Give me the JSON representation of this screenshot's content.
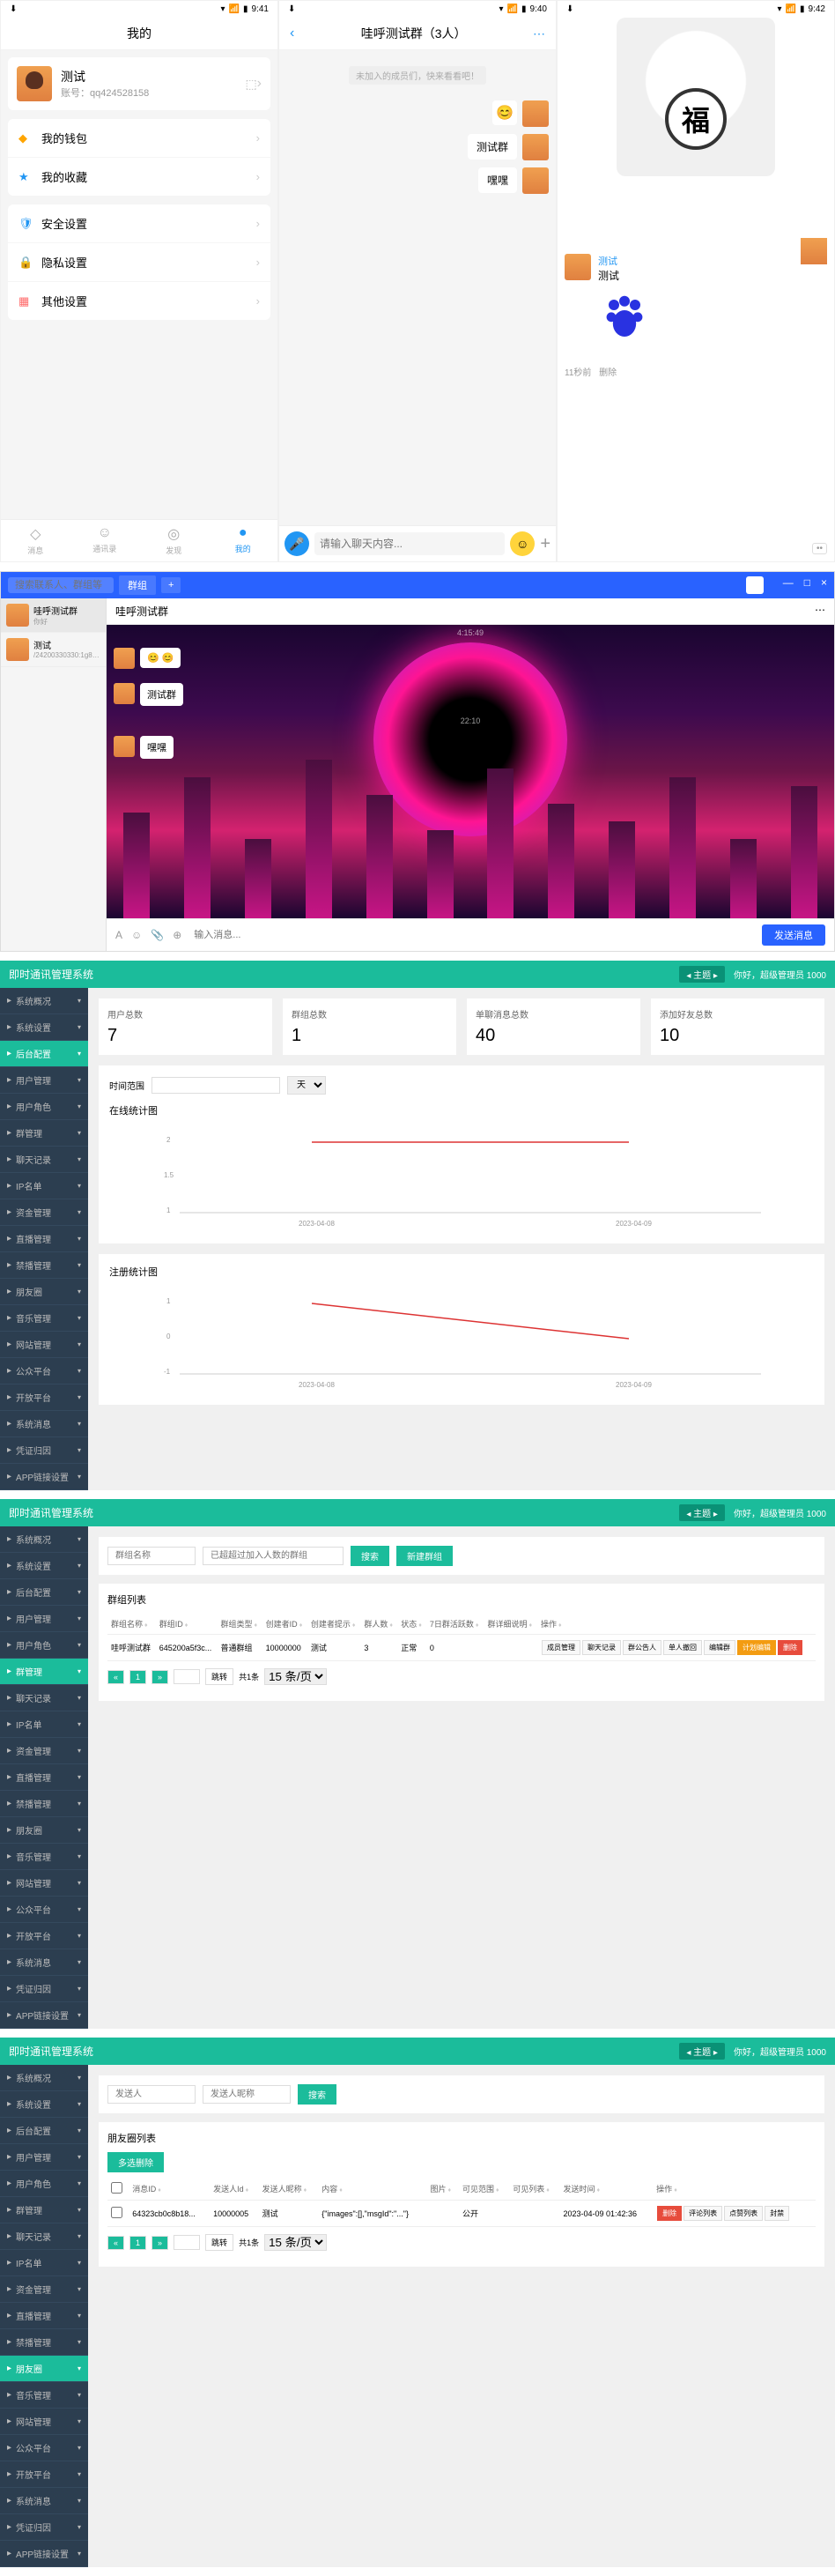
{
  "phones": {
    "status_time1": "9:41",
    "status_time2": "9:40",
    "status_time3": "9:42",
    "p1": {
      "title": "我的",
      "profile_name": "测试",
      "profile_id": "账号：qq424528158",
      "menu1": [
        {
          "label": "我的钱包"
        },
        {
          "label": "我的收藏"
        }
      ],
      "menu2": [
        {
          "label": "安全设置"
        },
        {
          "label": "隐私设置"
        },
        {
          "label": "其他设置"
        }
      ],
      "nav": [
        {
          "label": "消息"
        },
        {
          "label": "通讯录"
        },
        {
          "label": "发现"
        },
        {
          "label": "我的"
        }
      ]
    },
    "p2": {
      "title": "哇呼测试群（3人）",
      "notice": "未加入的成员们，快来看看吧！",
      "msgs": [
        {
          "text": "😊"
        },
        {
          "text": "测试群"
        },
        {
          "text": "嘿嘿"
        }
      ],
      "input_ph": "请输入聊天内容..."
    },
    "p3": {
      "fu": "福",
      "msg_name": "测试",
      "msg_text": "测试",
      "meta_time": "11秒前",
      "meta_del": "删除"
    }
  },
  "desktop": {
    "search_ph": "搜索联系人、群组等",
    "tab": "群组",
    "contacts": [
      {
        "name": "哇呼测试群",
        "sub": "你好",
        "badge": ""
      },
      {
        "name": "哇呼测试群",
        "sub": "",
        "badge": ""
      },
      {
        "name": "测试",
        "sub": "/24200330330:1g89=g...",
        "badge": ""
      }
    ],
    "chat_title": "哇呼测试群",
    "chat_more": "⋯",
    "time": "4:15:49",
    "msgs": [
      {
        "text": "😊 😊"
      },
      {
        "text": "测试群"
      },
      {
        "text": "嘿嘿"
      }
    ],
    "input_ph": "输入消息...",
    "send": "发送消息",
    "chat_time2": "22:10"
  },
  "admin_common": {
    "title": "即时通讯管理系统",
    "theme_btn": "主题",
    "user_info": "你好，超级管理员 1000",
    "sidebar": [
      {
        "label": "系统概况"
      },
      {
        "label": "系统设置"
      },
      {
        "label": "后台配置"
      },
      {
        "label": "用户管理"
      },
      {
        "label": "用户角色"
      },
      {
        "label": "群管理"
      },
      {
        "label": "聊天记录"
      },
      {
        "label": "IP名单"
      },
      {
        "label": "资金管理"
      },
      {
        "label": "直播管理"
      },
      {
        "label": "禁播管理"
      },
      {
        "label": "朋友圈"
      },
      {
        "label": "音乐管理"
      },
      {
        "label": "网站管理"
      },
      {
        "label": "公众平台"
      },
      {
        "label": "开放平台"
      },
      {
        "label": "系统消息"
      },
      {
        "label": "凭证归因"
      },
      {
        "label": "APP链接设置"
      }
    ]
  },
  "admin1": {
    "active_item": "后台配置",
    "stats": [
      {
        "label": "用户总数",
        "val": "7"
      },
      {
        "label": "群组总数",
        "val": "1"
      },
      {
        "label": "单聊消息总数",
        "val": "40"
      },
      {
        "label": "添加好友总数",
        "val": "10"
      }
    ],
    "time_range_label": "时间范围",
    "unit_label": "天",
    "chart1_title": "在线统计图",
    "chart2_title": "注册统计图",
    "x_labels": [
      "2023-04-08",
      "2023-04-09"
    ]
  },
  "admin2": {
    "active_item": "群管理",
    "f1_ph": "群组名称",
    "f2_ph": "已超超过加入人数的群组",
    "btn_search": "搜索",
    "btn_new": "新建群组",
    "table_title": "群组列表",
    "cols": [
      "群组名称",
      "群组ID",
      "群组类型",
      "创建者ID",
      "创建者提示",
      "群人数",
      "状态",
      "7日群活跃数",
      "群详细说明",
      "操作"
    ],
    "row": [
      "哇呼测试群",
      "645200a5f3c...",
      "普通群组",
      "10000000",
      "测试",
      "3",
      "正常",
      "0",
      "",
      ""
    ],
    "ops": [
      "成员管理",
      "聊天记录",
      "群公告人",
      "单人撤回",
      "编辑群",
      "计划编辑",
      "删除"
    ],
    "pager": {
      "page": "1",
      "total": "共1条",
      "size": "15 条/页"
    },
    "jump": "跳转"
  },
  "admin3": {
    "active_item": "朋友圈",
    "f1_ph": "发送人",
    "f2_ph": "发送人昵称",
    "btn_search": "搜索",
    "table_title": "朋友圈列表",
    "btn_multi": "多选删除",
    "cols": [
      "消息ID",
      "发送人Id",
      "发送人昵称",
      "内容",
      "图片",
      "可见范围",
      "可见列表",
      "发送时间",
      "操作"
    ],
    "row": [
      "64323cb0c8b18...",
      "10000005",
      "测试",
      "{\"images\":[],\"msgId\":\"...\"}",
      "",
      "公开",
      "",
      "2023-04-09 01:42:36",
      ""
    ],
    "ops": [
      "删除",
      "评论列表",
      "点赞列表",
      "封禁"
    ],
    "pager": {
      "page": "1",
      "total": "共1条",
      "size": "15 条/页"
    },
    "jump": "跳转"
  },
  "chart_data": [
    {
      "type": "line",
      "title": "在线统计图",
      "x": [
        "2023-04-08",
        "2023-04-09"
      ],
      "values": [
        2,
        2
      ],
      "ylim": [
        1,
        2.5
      ],
      "yticks": [
        1,
        1.5,
        2
      ]
    },
    {
      "type": "line",
      "title": "注册统计图",
      "x": [
        "2023-04-08",
        "2023-04-09"
      ],
      "values": [
        1,
        0
      ],
      "ylim": [
        -1,
        1
      ],
      "yticks": [
        -1,
        0,
        1
      ]
    }
  ]
}
